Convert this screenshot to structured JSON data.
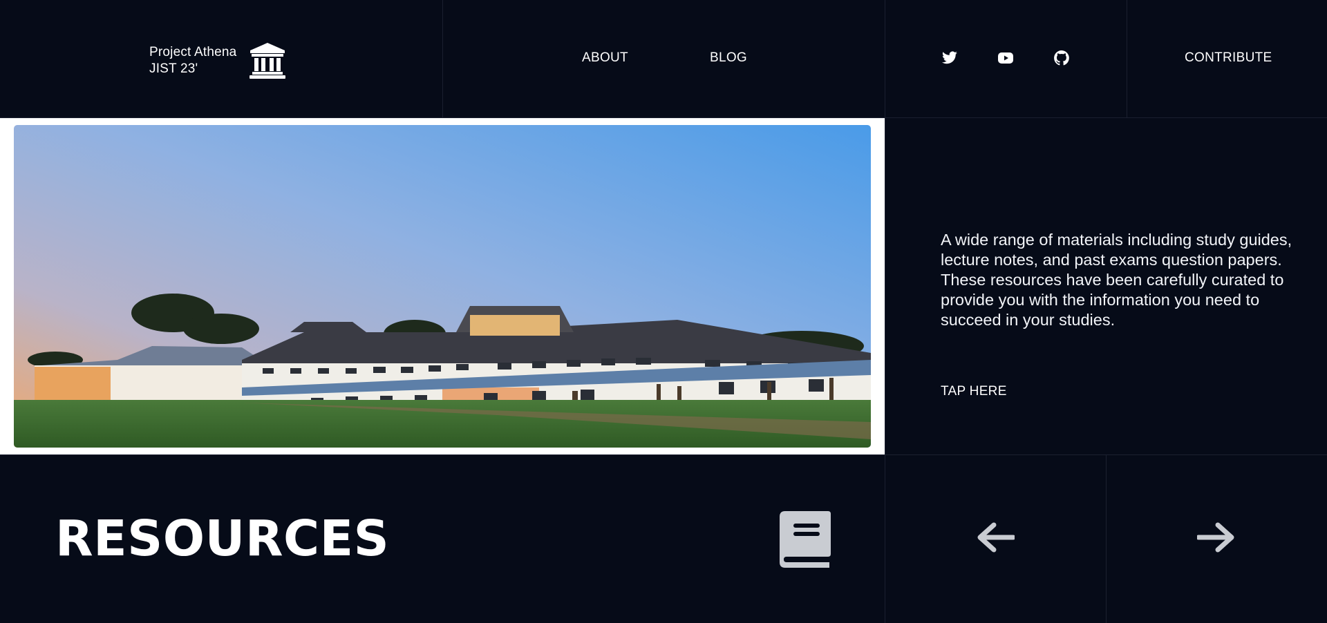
{
  "header": {
    "brand_line1": "Project Athena",
    "brand_line2": "JIST 23'",
    "brand_icon": "institution-icon",
    "nav": {
      "about": "ABOUT",
      "blog": "BLOG"
    },
    "social": [
      "twitter-icon",
      "youtube-icon",
      "github-icon"
    ],
    "contribute": "CONTRIBUTE"
  },
  "hero": {
    "image_alt": "Campus building at sunset",
    "description": "A wide range of materials including study guides, lecture notes, and past exams question papers. These resources have been carefully curated to provide you with the information you need to succeed in your studies.",
    "cta": "TAP HERE"
  },
  "section": {
    "title": "RESOURCES",
    "icon": "book-icon",
    "prev_icon": "arrow-left-icon",
    "next_icon": "arrow-right-icon"
  },
  "colors": {
    "background": "#060b18",
    "grid_line": "#1b2030",
    "text": "#ffffff",
    "icon_muted": "#c9ccd2"
  }
}
